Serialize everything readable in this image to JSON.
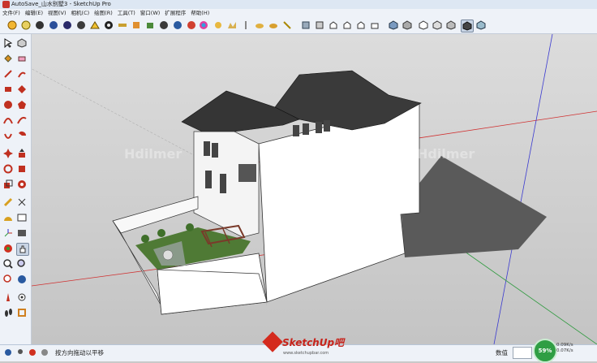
{
  "window": {
    "title": "AutoSave_山水别墅3 - SketchUp Pro"
  },
  "menu": [
    "文件(F)",
    "编辑(E)",
    "视图(V)",
    "相机(C)",
    "绘图(R)",
    "工具(T)",
    "窗口(W)",
    "扩展程序",
    "帮助(H)"
  ],
  "toolbar_icons": [
    "orbit-icon",
    "pan-icon",
    "zoom-icon",
    "zoom-extents-icon",
    "prev-view-icon",
    "next-view-icon",
    "walk-icon",
    "look-around-icon",
    "position-camera-icon",
    "section-plane-icon",
    "shadow-icon",
    "fog-icon",
    "sun-icon",
    "light-icon",
    "color-wheel-icon",
    "sandbox-icon",
    "terrain-icon",
    "smoove-icon",
    "stamp-icon",
    "drape-icon",
    "flip-icon",
    "iso-view-icon",
    "top-view-icon",
    "front-view-icon",
    "right-view-icon",
    "back-view-icon",
    "left-view-icon",
    "xray-icon",
    "wireframe-icon",
    "hidden-line-icon",
    "shaded-icon",
    "textured-icon",
    "monochrome-icon"
  ],
  "status": {
    "hint": "按方向拖动以平移",
    "value_label": "数值"
  },
  "network": {
    "percent": "59%",
    "up": "0.09K/s",
    "down": "0.07K/s"
  },
  "branding": {
    "logo_text": "SketchUp吧",
    "logo_sub": "www.sketchupbar.com"
  },
  "watermarks": [
    "Hdilmer",
    "Hdilmer"
  ],
  "colors": {
    "axis_red": "#d03030",
    "axis_green": "#2e9a3e",
    "axis_blue": "#3a3ad0",
    "roof": "#3a3a3a",
    "wall": "#ffffff",
    "shadow": "#5a5a5a"
  }
}
